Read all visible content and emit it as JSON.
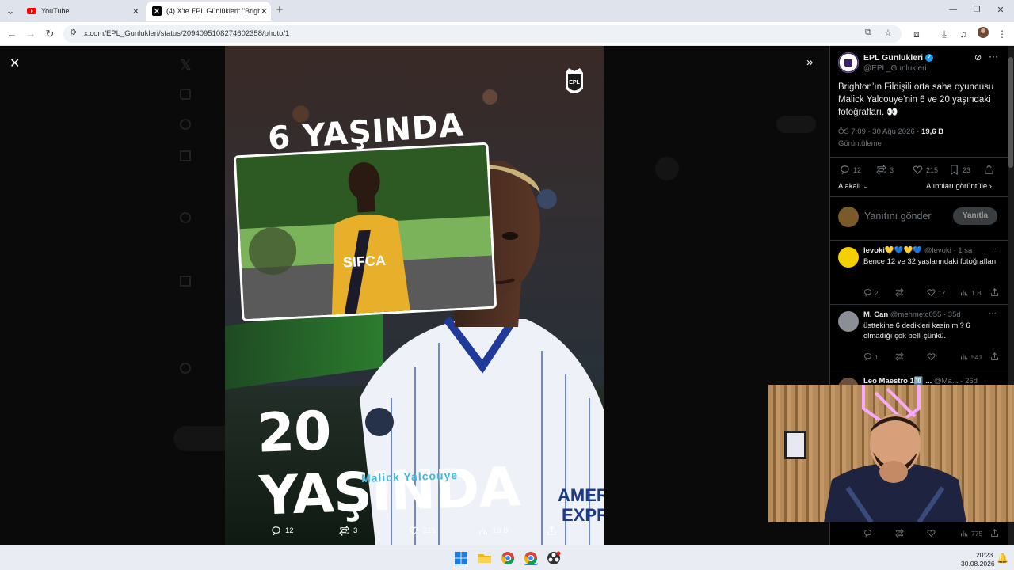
{
  "browser": {
    "tabs": [
      {
        "title": "YouTube",
        "icon": "youtube-icon"
      },
      {
        "title": "(4) X'te EPL Günlükleri: \"Brighto",
        "icon": "x-logo-icon"
      }
    ],
    "new_tab_label": "+",
    "url": "x.com/EPL_Gunlukleri/status/2094095108274602358/photo/1"
  },
  "viewer": {
    "image_text": {
      "title_top": "6 YAŞINDA",
      "title_bottom": "20 YAŞINDA",
      "player_name": "Malick Yalcouye",
      "badge_text": "EPL"
    },
    "actions": {
      "replies": "12",
      "reposts": "3",
      "likes": "215",
      "views": "19 B"
    }
  },
  "tweet": {
    "account_name": "EPL Günlükleri",
    "account_handle": "@EPL_Gunlukleri",
    "text": "Brighton’ın Fildişili orta saha oyuncusu Malick Yalcouye’nin 6 ve 20 yaşındaki fotoğrafları. 👀",
    "time": "ÖS 7:09 · 30 Ağu 2026 · ",
    "views_count": "19,6 B",
    "views_label": "Görüntüleme",
    "stats": {
      "replies": "12",
      "reposts": "3",
      "likes": "215",
      "bookmarks": "23"
    },
    "sort_label": "Alakalı",
    "quotes_label": "Alıntıları görüntüle",
    "reply_placeholder": "Yanıtını gönder",
    "reply_button": "Yanıtla"
  },
  "replies": [
    {
      "name": "levoki💛💙💛💙",
      "handle": "@levoki · 1 sa",
      "text": "Bence 12 ve 32 yaşlarındaki fotoğrafları",
      "replies": "2",
      "reposts": "",
      "likes": "17",
      "views": "1 B"
    },
    {
      "name": "M. Can",
      "handle": "@mehmetc055 · 35d",
      "text": "üsttekine 6 dedikleri kesin mi? 6 olmadığı çok belli çünkü.",
      "replies": "1",
      "reposts": "",
      "likes": "",
      "views": "541"
    },
    {
      "name": "Leo Maestro 1🔟 ...",
      "handle": "@Ma... · 26d",
      "text": "",
      "replies": "",
      "reposts": "",
      "likes": "",
      "views": "775"
    }
  ],
  "taskbar": {
    "time": "20:23",
    "date": "30.08.2026"
  },
  "colors": {
    "accent": "#1d9bf0",
    "name_blue": "#3fb7e8",
    "verified": "#1d9bf0"
  }
}
